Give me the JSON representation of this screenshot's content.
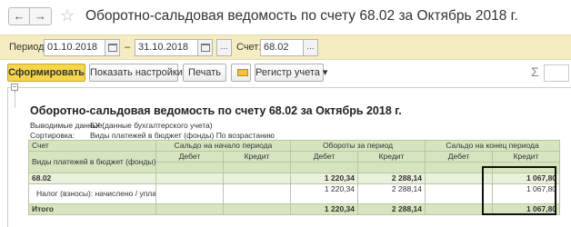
{
  "window": {
    "title": "Оборотно-сальдовая ведомость по счету 68.02 за Октябрь 2018 г.",
    "back_glyph": "←",
    "forward_glyph": "→",
    "star_glyph": "☆"
  },
  "period": {
    "label": "Период:",
    "from": "01.10.2018",
    "dash": "–",
    "to": "31.10.2018",
    "more_button": "...",
    "account_label": "Счет:",
    "account_value": "68.02"
  },
  "toolbar": {
    "generate": "Сформировать",
    "settings": "Показать настройки",
    "print": "Печать",
    "register": "Регистр учета ▾",
    "sigma": "Σ"
  },
  "report": {
    "title": "Оборотно-сальдовая ведомость по счету 68.02 за Октябрь 2018 г.",
    "data_label": "Выводимые данные:",
    "data_value": "БУ (данные бухгалтерского учета)",
    "sort_label": "Сортировка:",
    "sort_value": "Виды платежей в бюджет (фонды) По возрастанию"
  },
  "table": {
    "col_account": "Счет",
    "col_subkonto": "Виды платежей в бюджет (фонды)",
    "group_start": "Сальдо на начало периода",
    "group_turnover": "Обороты за период",
    "group_end": "Сальдо на конец периода",
    "debit": "Дебет",
    "credit": "Кредит",
    "rows": [
      {
        "name": "68.02",
        "start_debit": "",
        "start_credit": "",
        "turn_debit": "1 220,34",
        "turn_credit": "2 288,14",
        "end_debit": "",
        "end_credit": "1 067,80"
      },
      {
        "name": "Налог (взносы): начислено / уплачено",
        "start_debit": "",
        "start_credit": "",
        "turn_debit": "1 220,34",
        "turn_credit": "2 288,14",
        "end_debit": "",
        "end_credit": "1 067,80"
      }
    ],
    "total": {
      "name": "Итого",
      "start_debit": "",
      "start_credit": "",
      "turn_debit": "1 220,34",
      "turn_credit": "2 288,14",
      "end_debit": "",
      "end_credit": "1 067,80"
    }
  }
}
